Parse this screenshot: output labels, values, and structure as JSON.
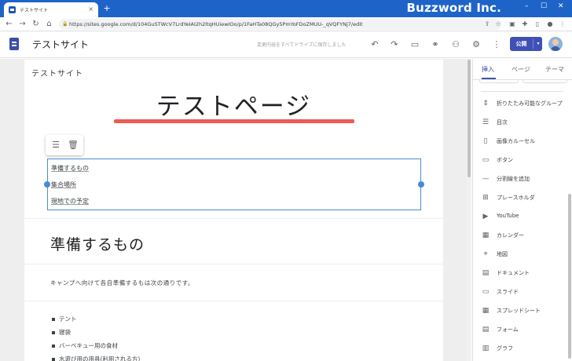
{
  "browser": {
    "tab_title": "テストサイト",
    "tab_close": "×",
    "new_tab": "+",
    "brand": "Buzzword Inc.",
    "url": "https://sites.google.com/d/104GuSTWcV7LrdYeIAI2h2ltqHUiewIOo/p/1FaHTa08QGy5PmYoFDoZMUU-_qVQFYNj7/edit",
    "win_min": "–",
    "win_max": "☐",
    "win_close": "✕"
  },
  "header": {
    "site_title": "テストサイト",
    "save_status": "変更内容をすべてドライブに保存しました",
    "publish_label": "公開",
    "publish_dropdown": "▾"
  },
  "page": {
    "site_name": "テストサイト",
    "title": "テストページ",
    "toc": [
      "準備するもの",
      "集合場所",
      "現地での予定"
    ],
    "section_heading": "準備するもの",
    "paragraph": "キャンプへ向けて各自準備するもは次の通りです。",
    "bullets": [
      "テント",
      "寝袋",
      "バーベキュー用の食材",
      "水遊び用の用具(利用される方)"
    ]
  },
  "panel": {
    "tabs": [
      "挿入",
      "ページ",
      "テーマ"
    ],
    "active_tab": "挿入",
    "items": [
      {
        "icon": "collapsible-icon",
        "glyph": "⇕",
        "label": "折りたたみ可能なグループ"
      },
      {
        "icon": "toc-icon",
        "glyph": "☰",
        "label": "目次"
      },
      {
        "icon": "carousel-icon",
        "glyph": "▯",
        "label": "画像カルーセル"
      },
      {
        "icon": "button-icon",
        "glyph": "▭",
        "label": "ボタン"
      },
      {
        "icon": "divider-icon",
        "glyph": "—",
        "label": "分割線を追加"
      },
      {
        "icon": "placeholder-icon",
        "glyph": "⊞",
        "label": "プレースホルダ"
      },
      {
        "icon": "youtube-icon",
        "glyph": "▶",
        "label": "YouTube"
      },
      {
        "icon": "calendar-icon",
        "glyph": "▦",
        "label": "カレンダー"
      },
      {
        "icon": "map-icon",
        "glyph": "⌖",
        "label": "地図"
      },
      {
        "icon": "docs-icon",
        "glyph": "▤",
        "label": "ドキュメント"
      },
      {
        "icon": "slides-icon",
        "glyph": "▭",
        "label": "スライド"
      },
      {
        "icon": "sheets-icon",
        "glyph": "▦",
        "label": "スプレッドシート"
      },
      {
        "icon": "forms-icon",
        "glyph": "▤",
        "label": "フォーム"
      },
      {
        "icon": "chart-icon",
        "glyph": "▥",
        "label": "グラフ"
      }
    ]
  },
  "colors": {
    "accent": "#3f51b5",
    "title_underline": "#ee5a55",
    "selection": "#4a8ad8",
    "browser_bar": "#1e64c8"
  }
}
